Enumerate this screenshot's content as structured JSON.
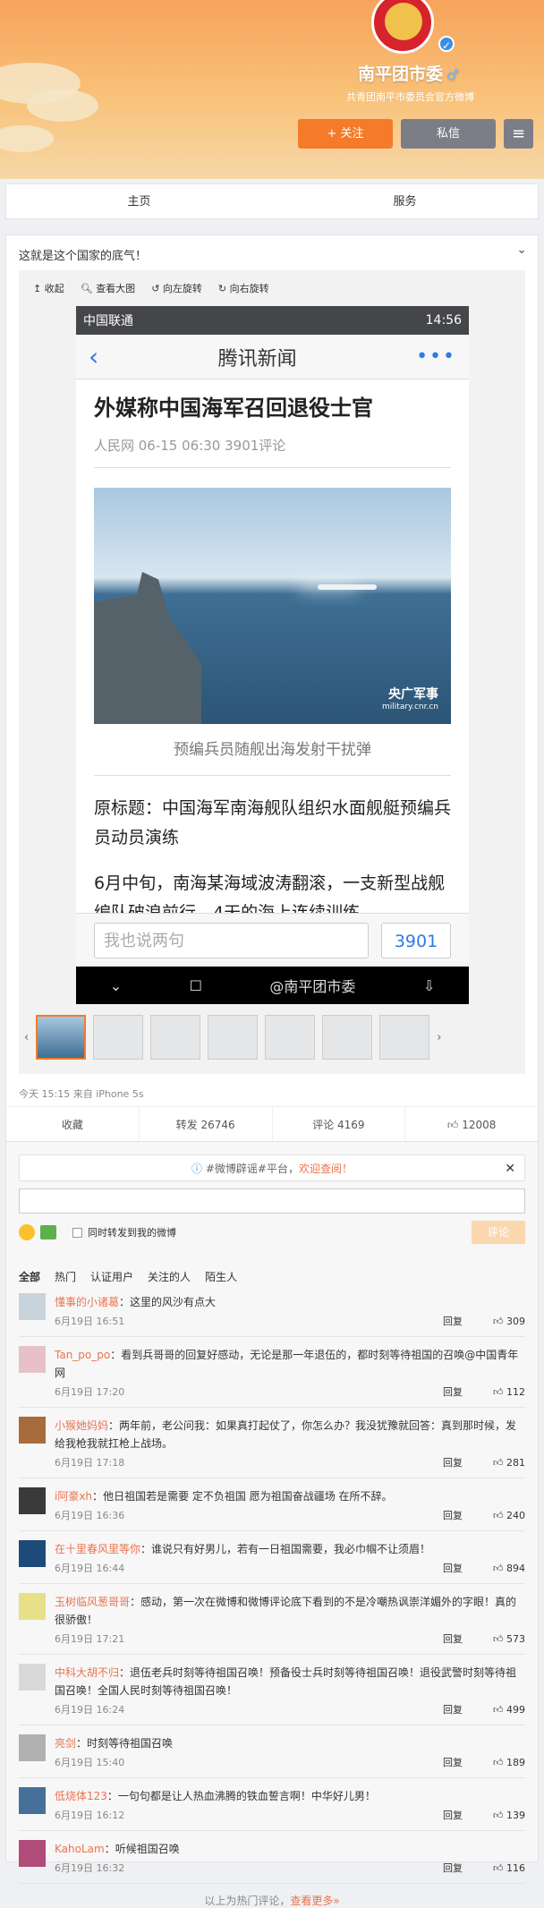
{
  "profile": {
    "name": "南平团市委",
    "gender_icon": "male-icon",
    "verify_icon": "verified-icon",
    "bio": "共青团南平市委员会官方微博",
    "follow_label": "+ 关注",
    "message_label": "私信"
  },
  "nav": {
    "tabs": [
      "主页",
      "服务"
    ]
  },
  "post": {
    "text": "这就是这个国家的底气！",
    "toolbar": [
      "收起",
      "查看大图",
      "向左旋转",
      "向右旋转"
    ],
    "screenshot": {
      "carrier": "中国联通",
      "time": "14:56",
      "app_title": "腾讯新闻",
      "article_title": "外媒称中国海军召回退役士官",
      "article_meta": "人民网 06-15 06:30 3901评论",
      "image_watermark": "央广军事",
      "image_watermark_url": "military.cnr.cn",
      "caption": "预编兵员随舰出海发射干扰弹",
      "subtitle": "原标题：中国海军南海舰队组织水面舰艇预编兵员动员演练",
      "body": "6月中旬，南海某海域波涛翻滚，一支新型战舰编队破浪前行。4天的海上连续训练",
      "comment_placeholder": "我也说两句",
      "comment_count": "3901",
      "watermark": "@南平团市委"
    },
    "time": "今天 15:15 来自 iPhone 5s",
    "actions": [
      "收藏",
      "转发 26746",
      "评论 4169",
      "12008"
    ]
  },
  "comments_section": {
    "notice_text": "#微博辟谣#平台，",
    "notice_link": "欢迎查阅！",
    "repost_label": "同时转发到我的微博",
    "submit_label": "评论",
    "filters": [
      "全部",
      "热门",
      "认证用户",
      "关注的人",
      "陌生人"
    ],
    "reply_label": "回复",
    "items": [
      {
        "user": "懂事的小诸葛",
        "text": "这里的风沙有点大",
        "time": "6月19日 16:51",
        "likes": "309"
      },
      {
        "user": "Tan_po_po",
        "text": "看到兵哥哥的回复好感动，无论是那一年退伍的，都时刻等待祖国的召唤@中国青年网",
        "time": "6月19日 17:20",
        "likes": "112"
      },
      {
        "user": "小猴她妈妈",
        "text": "两年前，老公问我：如果真打起仗了，你怎么办？我没犹豫就回答：真到那时候，发给我枪我就扛枪上战场。",
        "time": "6月19日 17:18",
        "likes": "281"
      },
      {
        "user": "i阿豪xh",
        "text": "他日祖国若是需要 定不负祖国 愿为祖国奋战疆场 在所不辞。",
        "time": "6月19日 16:36",
        "likes": "240"
      },
      {
        "user": "在十里春风里等你",
        "text": "谁说只有好男儿，若有一日祖国需要，我必巾帼不让须眉！",
        "time": "6月19日 16:44",
        "likes": "894"
      },
      {
        "user": "玉树临风葱哥哥",
        "text": "感动，第一次在微博和微博评论底下看到的不是冷嘲热讽崇洋媚外的字眼！真的很骄傲！",
        "time": "6月19日 17:21",
        "likes": "573"
      },
      {
        "user": "中科大胡不归",
        "text": "退伍老兵时刻等待祖国召唤！预备役士兵时刻等待祖国召唤！退役武警时刻等待祖国召唤！全国人民时刻等待祖国召唤！",
        "time": "6月19日 16:24",
        "likes": "499"
      },
      {
        "user": "亮剑",
        "text": "时刻等待祖国召唤",
        "time": "6月19日 15:40",
        "likes": "189"
      },
      {
        "user": "低烧体123",
        "text": "一句句都是让人热血沸腾的铁血誓言啊！中华好儿男！",
        "time": "6月19日 16:12",
        "likes": "139"
      },
      {
        "user": "KahoLam",
        "text": "听候祖国召唤",
        "time": "6月19日 16:32",
        "likes": "116"
      }
    ],
    "footer_text": "以上为热门评论，",
    "footer_link": "查看更多»"
  }
}
